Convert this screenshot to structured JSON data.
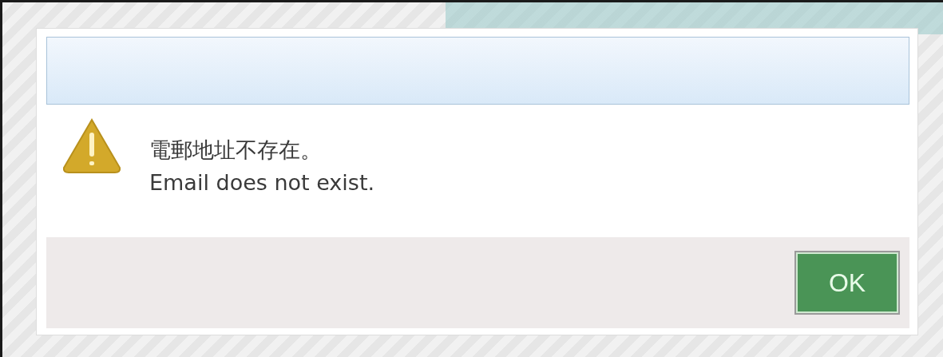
{
  "dialog": {
    "message": {
      "kind": "warning",
      "lines": [
        "電郵地址不存在。",
        "Email does not exist."
      ]
    },
    "buttons": [
      {
        "label": "OK",
        "kind": "primary"
      }
    ]
  }
}
